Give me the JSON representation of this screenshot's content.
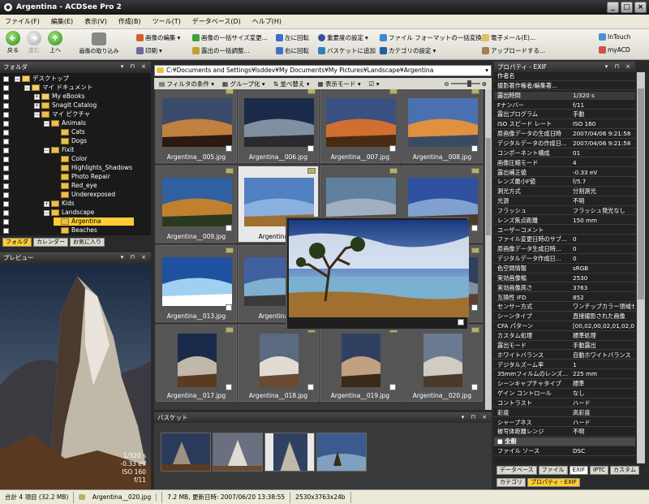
{
  "window": {
    "title": "Argentina - ACDSee Pro 2"
  },
  "menu": [
    "ファイル(F)",
    "編集(E)",
    "表示(V)",
    "作成(B)",
    "ツール(T)",
    "データベース(D)",
    "ヘルプ(H)"
  ],
  "nav": {
    "back": "戻る",
    "forward": "進む",
    "up": "上へ",
    "import": "画像の取り込み"
  },
  "toolbar": {
    "edit_image": "画像の編集",
    "batch_resize": "画像の一括サイズ変更...",
    "rotate_left": "左に回転",
    "rate": "重要度の設定",
    "batch_format": "ファイル フォーマットの一括変換...",
    "email": "電子メール(E)...",
    "intouch": "InTouch",
    "print": "印刷",
    "batch_exposure": "露出の一括調整...",
    "rotate_right": "右に回転",
    "add_basket": "バスケットに追加",
    "set_category": "カテゴリの設定",
    "upload": "アップロードする...",
    "myacd": "myACD"
  },
  "folders": {
    "title": "フォルダ",
    "items": [
      {
        "label": "デスクトップ",
        "level": 0,
        "sel": false
      },
      {
        "label": "マイ ドキュメント",
        "level": 1,
        "sel": false
      },
      {
        "label": "My eBooks",
        "level": 2,
        "sel": false
      },
      {
        "label": "SnagIt Catalog",
        "level": 2,
        "sel": false
      },
      {
        "label": "マイ ピクチャ",
        "level": 2,
        "sel": false
      },
      {
        "label": "Animals",
        "level": 3,
        "sel": false
      },
      {
        "label": "Cats",
        "level": 4,
        "sel": false
      },
      {
        "label": "Dogs",
        "level": 4,
        "sel": false
      },
      {
        "label": "Fixit",
        "level": 3,
        "sel": false
      },
      {
        "label": "Color",
        "level": 4,
        "sel": false
      },
      {
        "label": "Highlights_Shadows",
        "level": 4,
        "sel": false
      },
      {
        "label": "Photo Repair",
        "level": 4,
        "sel": false
      },
      {
        "label": "Red_eye",
        "level": 4,
        "sel": false
      },
      {
        "label": "Underexposed",
        "level": 4,
        "sel": false
      },
      {
        "label": "Kids",
        "level": 3,
        "sel": false
      },
      {
        "label": "Landscape",
        "level": 3,
        "sel": false
      },
      {
        "label": "Argentina",
        "level": 4,
        "sel": true
      },
      {
        "label": "Beaches",
        "level": 4,
        "sel": false
      }
    ]
  },
  "left_tabs": [
    "フォルダ",
    "カレンダー",
    "お気に入り"
  ],
  "preview": {
    "title": "プレビュー",
    "info": [
      "1/320 s",
      "-0.33 eV",
      "ISO 160",
      "f/11"
    ]
  },
  "address": "C:¥Documents and Settings¥lsddev¥My Documents¥My Pictures¥Landscape¥Argentina",
  "subtoolbar": {
    "filter": "フィルタの条件",
    "group": "グループ化",
    "sort": "並べ替え",
    "view": "表示モード"
  },
  "thumbs": [
    "Argentina__005.jpg",
    "Argentina__006.jpg",
    "Argentina__007.jpg",
    "Argentina__008.jpg",
    "Argentina__009.jpg",
    "Argentina__0",
    "",
    "",
    "Argentina__013.jpg",
    "Argentina__0",
    "",
    "",
    "Argentina__017.jpg",
    "Argentina__018.jpg",
    "Argentina__019.jpg",
    "Argentina__020.jpg"
  ],
  "basket": {
    "title": "バスケット"
  },
  "properties": {
    "title": "プロパティ - EXIF",
    "rows": [
      [
        "作者名",
        ""
      ],
      [
        "撮影著作権者/編集著...",
        ""
      ],
      [
        "露出時間",
        "1/320 s"
      ],
      [
        "Fナンバー",
        "f/11"
      ],
      [
        "露出プログラム",
        "手動"
      ],
      [
        "ISO スピード レート",
        "ISO 160"
      ],
      [
        "原画像データの生成日時",
        "2007/04/06 9:21:58"
      ],
      [
        "デジタルデータの作成日...",
        "2007/04/06 9:21:58"
      ],
      [
        "コンポーネント構成",
        "01"
      ],
      [
        "画像圧縮モード",
        "4"
      ],
      [
        "露出補正値",
        "-0.33 eV"
      ],
      [
        "レンズ最小F値",
        "f/5.7"
      ],
      [
        "測光方式",
        "分割測光"
      ],
      [
        "光源",
        "不明"
      ],
      [
        "フラッシュ",
        "フラッシュ発光なし"
      ],
      [
        "レンズ焦点距離",
        "150 mm"
      ],
      [
        "ユーザーコメント",
        ""
      ],
      [
        "ファイル変更日時のサブ...",
        "0"
      ],
      [
        "原画像データ生成日時...",
        "0"
      ],
      [
        "デジタルデータ作成日...",
        "0"
      ],
      [
        "色空間情報",
        "sRGB"
      ],
      [
        "実効画像幅",
        "2530"
      ],
      [
        "実効画像高さ",
        "3763"
      ],
      [
        "互換性 IFD",
        "852"
      ],
      [
        "センサー方式",
        "ワンチップカラー領域セ..."
      ],
      [
        "シーンタイプ",
        "直接撮影された画像"
      ],
      [
        "CFA パターン",
        "[00,02,00,02,01,02,0..."
      ],
      [
        "カスタム処理",
        "標準処理"
      ],
      [
        "露出モード",
        "手動露出"
      ],
      [
        "ホワイトバランス",
        "自動ホワイトバランス"
      ],
      [
        "デジタルズーム率",
        "1"
      ],
      [
        "35mmフィルムのレンズ...",
        "225 mm"
      ],
      [
        "シーンキャプチャタイプ",
        "標準"
      ],
      [
        "ゲイン コントロール",
        "なし"
      ],
      [
        "コントラスト",
        "ハード"
      ],
      [
        "彩度",
        "高彩度"
      ],
      [
        "シャープネス",
        "ハード"
      ],
      [
        "被写体距離レンジ",
        "不明"
      ],
      [
        "■ 全般",
        ""
      ],
      [
        "ファイル ソース",
        "DSC"
      ]
    ]
  },
  "props_tabs": [
    "データベース",
    "ファイル",
    "EXIF",
    "IPTC",
    "カスタム"
  ],
  "props_tabs2": [
    "カテゴリ",
    "プロパティ - EXIF"
  ],
  "status": [
    "合計 4 項目 (32.2 MB)",
    "Argentina__020.jpg",
    "7.2 MB, 更新日時: 2007/06/20 13:38:55",
    "2530x3763x24b"
  ]
}
